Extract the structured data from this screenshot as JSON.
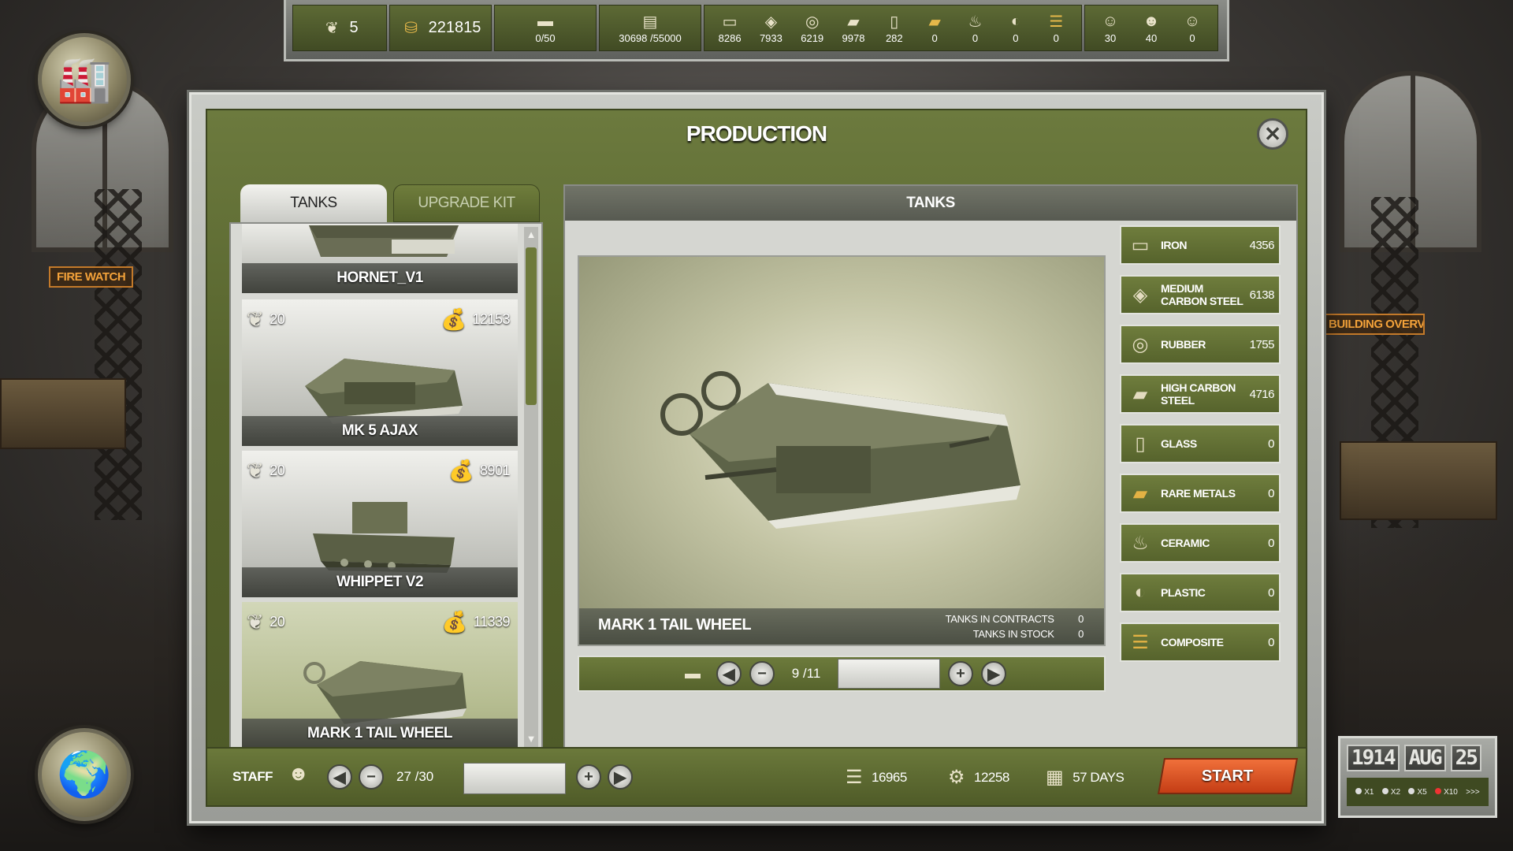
{
  "topbar": {
    "rank": "5",
    "money": "221815",
    "tanks_cap": "0/50",
    "storage": "30698 /55000",
    "materials": [
      "8286",
      "7933",
      "6219",
      "9978",
      "282",
      "0",
      "0",
      "0",
      "0"
    ],
    "staff": [
      "30",
      "40",
      "0"
    ]
  },
  "side_labels": {
    "left": "FIRE WATCH",
    "right": "BUILDING OVERVIEW"
  },
  "dialog": {
    "title": "PRODUCTION",
    "tabs": {
      "tanks": "TANKS",
      "upgrade_kit": "UPGRADE KIT"
    },
    "list": [
      {
        "name": "HORNET_V1",
        "rank": "",
        "cost": ""
      },
      {
        "name": "MK 5   AJAX",
        "rank": "20",
        "cost": "12153"
      },
      {
        "name": "WHIPPET  V2",
        "rank": "20",
        "cost": "8901"
      },
      {
        "name": "MARK 1 TAIL WHEEL",
        "rank": "20",
        "cost": "11339"
      }
    ],
    "right_header": "TANKS",
    "preview": {
      "name": "MARK 1 TAIL WHEEL",
      "contracts_label": "TANKS IN CONTRACTS",
      "contracts_value": "0",
      "stock_label": "TANKS IN STOCK",
      "stock_value": "0"
    },
    "counter": {
      "value": "9 /11"
    },
    "resources": [
      {
        "name": "IRON",
        "value": "4356",
        "icon": "iron-icon"
      },
      {
        "name": "MEDIUM CARBON STEEL",
        "value": "6138",
        "icon": "medium-carbon-steel-icon"
      },
      {
        "name": "RUBBER",
        "value": "1755",
        "icon": "rubber-icon"
      },
      {
        "name": "HIGH CARBON STEEL",
        "value": "4716",
        "icon": "high-carbon-steel-icon"
      },
      {
        "name": "GLASS",
        "value": "0",
        "icon": "glass-icon"
      },
      {
        "name": "RARE METALS",
        "value": "0",
        "icon": "rare-metals-icon"
      },
      {
        "name": "CERAMIC",
        "value": "0",
        "icon": "ceramic-icon"
      },
      {
        "name": "PLASTIC",
        "value": "0",
        "icon": "plastic-icon"
      },
      {
        "name": "COMPOSITE",
        "value": "0",
        "icon": "composite-icon"
      }
    ],
    "bottom": {
      "staff_label": "STAFF",
      "staff_value": "27 /30",
      "materials_total": "16965",
      "work_total": "12258",
      "days": "57 DAYS",
      "start_label": "START"
    }
  },
  "calendar": {
    "year": "1914",
    "month": "AUG",
    "day": "25",
    "speeds": [
      "X1",
      "X2",
      "X5",
      "X10",
      ">>>"
    ]
  }
}
